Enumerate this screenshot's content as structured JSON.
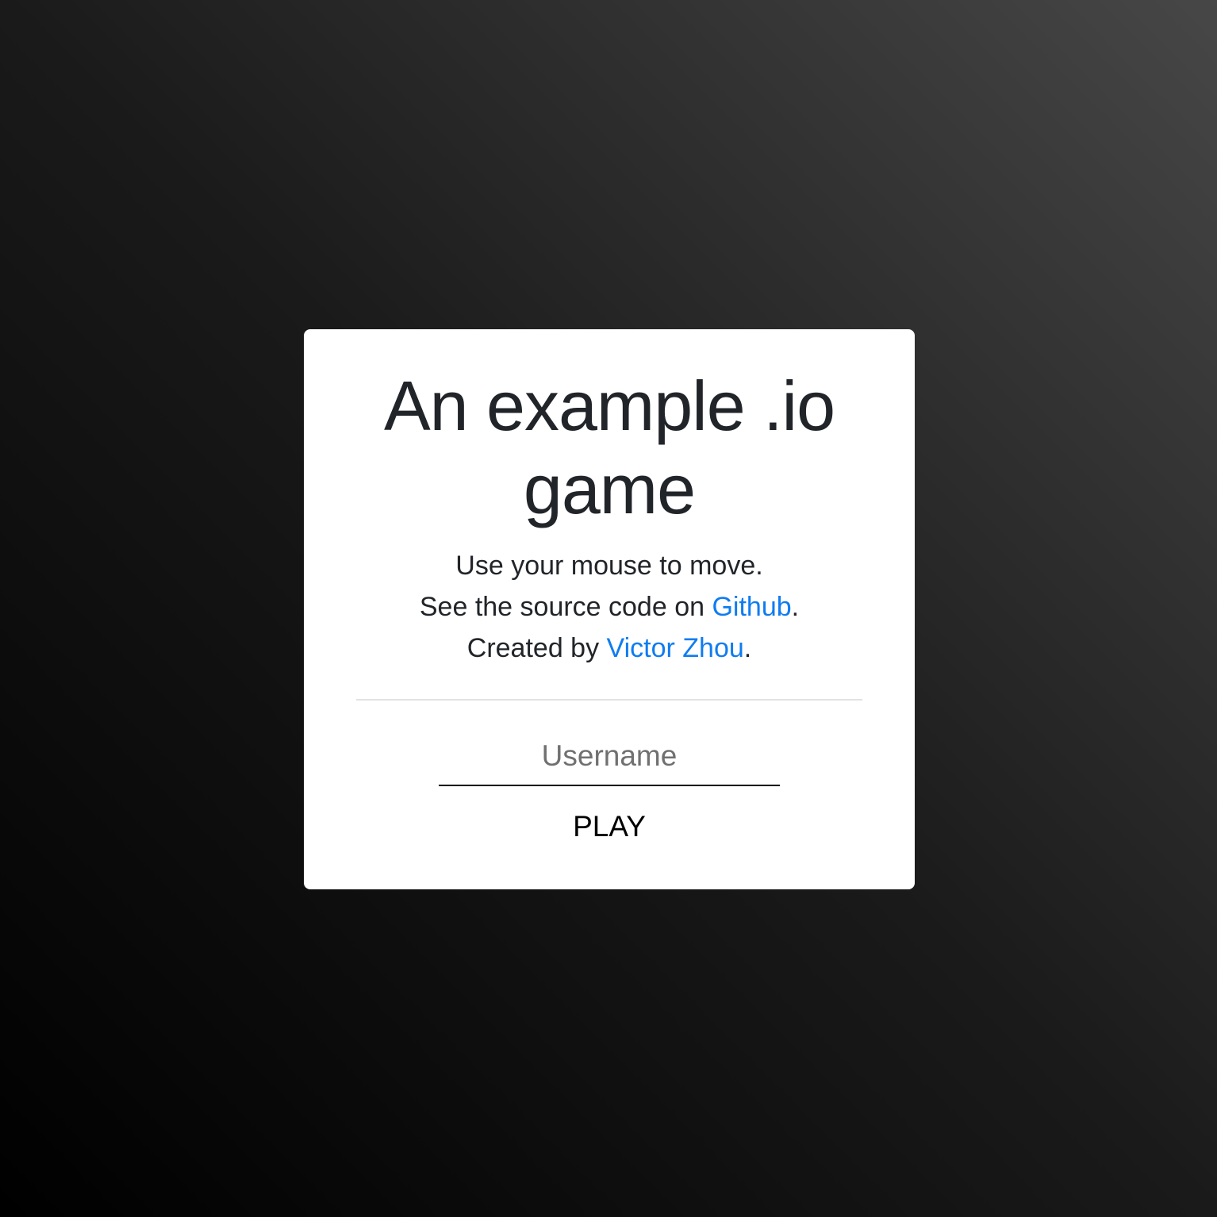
{
  "menu": {
    "title": "An example .io game",
    "instructions": "Use your mouse to move.",
    "source_prefix": "See the source code on ",
    "source_link": "Github",
    "source_suffix": ".",
    "credit_prefix": "Created by ",
    "credit_link": "Victor Zhou",
    "credit_suffix": ".",
    "username_placeholder": "Username",
    "username_value": "",
    "play_label": "PLAY"
  },
  "colors": {
    "link": "#0f7cf1",
    "text": "#212529",
    "card_background": "#ffffff",
    "divider": "#e2e2e2"
  }
}
